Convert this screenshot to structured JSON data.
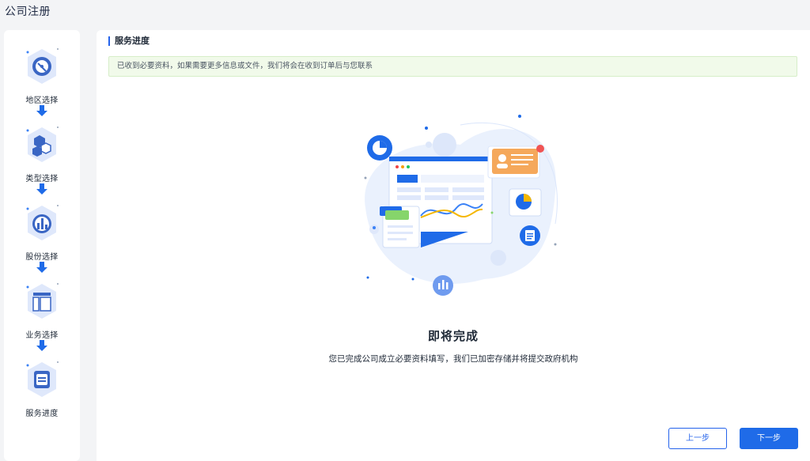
{
  "app": {
    "title": "公司注册"
  },
  "steps": [
    {
      "label": "地区选择",
      "icon": "location-icon"
    },
    {
      "label": "类型选择",
      "icon": "hexagon-icon"
    },
    {
      "label": "股份选择",
      "icon": "bar-chart-icon"
    },
    {
      "label": "业务选择",
      "icon": "layout-icon"
    },
    {
      "label": "服务进度",
      "icon": "document-icon"
    }
  ],
  "main": {
    "section_title": "服务进度",
    "notice": "已收到必要资料，如果需要更多信息或文件，我们将会在收到订单后与您联系",
    "done_title": "即将完成",
    "done_desc": "您已完成公司成立必要资料填写，我们已加密存储并将提交政府机构"
  },
  "buttons": {
    "prev": "上一步",
    "next": "下一步"
  },
  "colors": {
    "accent": "#1f6be8",
    "notice_bg": "#f1faea",
    "badge": "#dfe8fb"
  }
}
